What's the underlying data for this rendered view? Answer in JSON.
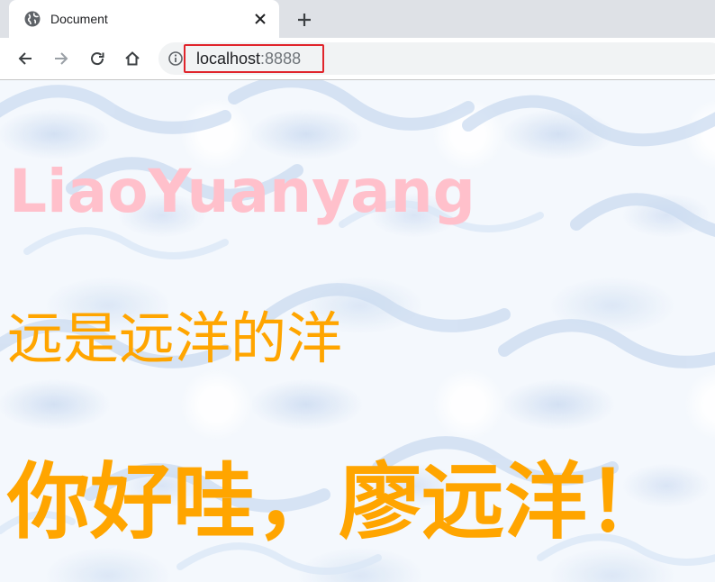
{
  "browser": {
    "tab": {
      "title": "Document",
      "favicon": "globe-icon",
      "close_icon": "close-icon"
    },
    "new_tab_icon": "plus-icon",
    "nav": {
      "back": "back-arrow-icon",
      "forward": "forward-arrow-icon",
      "reload": "reload-icon",
      "home": "home-icon"
    },
    "address": {
      "host": "localhost",
      "port": ":8888",
      "site_info_icon": "info-icon",
      "highlight_color": "#e0242b"
    }
  },
  "page": {
    "heading_en": "LiaoYuanyang",
    "heading_cn1": "远是远洋的洋",
    "heading_cn2": "你好哇，廖远洋！",
    "colors": {
      "heading_en": "#ffc0cb",
      "heading_cn": "#ffa500"
    }
  }
}
